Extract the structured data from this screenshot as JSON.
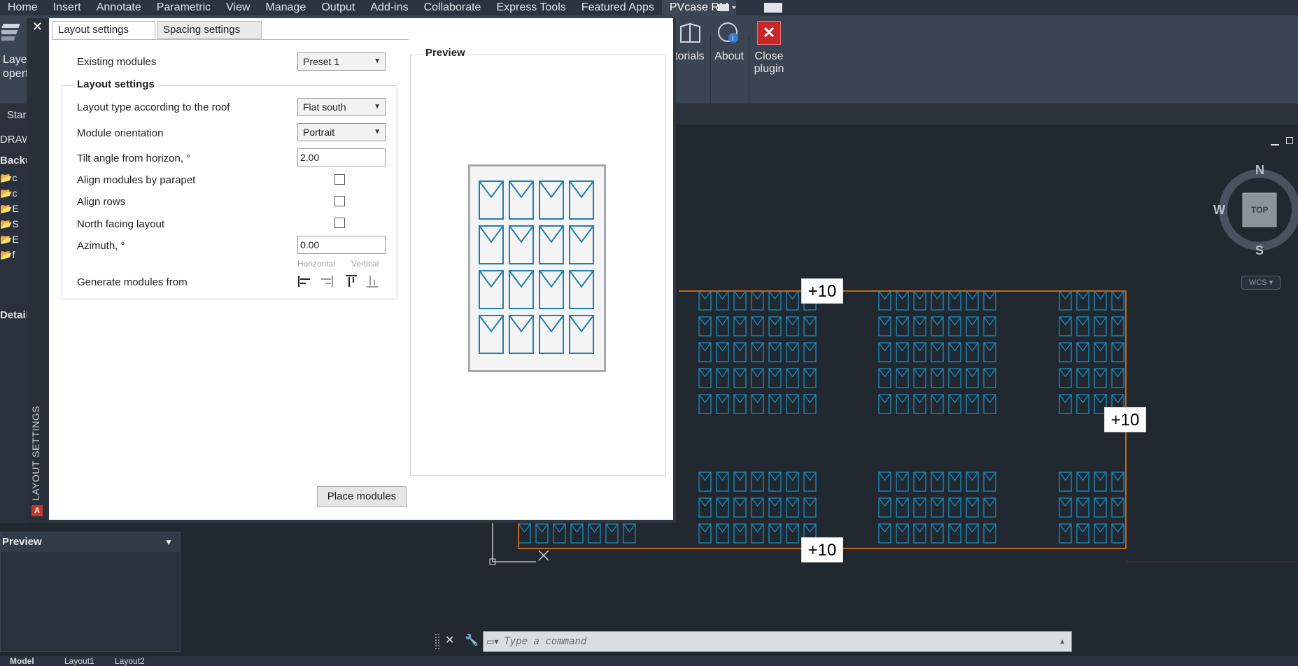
{
  "ribbon": {
    "tabs": [
      "Home",
      "Insert",
      "Annotate",
      "Parametric",
      "View",
      "Manage",
      "Output",
      "Add-ins",
      "Collaborate",
      "Express Tools",
      "Featured Apps",
      "PVcase RM"
    ],
    "active_tab": "PVcase RM",
    "buttons": {
      "layer_props_1": "Layer",
      "layer_props_2": "opert",
      "tutorials": "torials",
      "about": "About",
      "close_plugin_1": "Close",
      "close_plugin_2": "plugin"
    }
  },
  "left_palette": {
    "start_label": "Star",
    "draw_label": "DRAW",
    "backup_label": "Backup",
    "tree_items": [
      "c",
      "c",
      "E",
      "S",
      "E",
      "f"
    ],
    "details_label": "Details",
    "preview_label": "Preview"
  },
  "plugin": {
    "side_label": "LAYOUT SETTINGS",
    "close_glyph": "✕",
    "tabs": [
      "Layout settings",
      "Spacing settings"
    ],
    "existing_modules_label": "Existing modules",
    "existing_modules_value": "Preset 1",
    "group_title": "Layout settings",
    "layout_type_label": "Layout type according to the roof",
    "layout_type_value": "Flat south",
    "orientation_label": "Module orientation",
    "orientation_value": "Portrait",
    "tilt_label": "Tilt angle from horizon, °",
    "tilt_value": "2.00",
    "align_parapet_label": "Align modules by parapet",
    "align_rows_label": "Align rows",
    "north_label": "North facing layout",
    "azimuth_label": "Azimuth, °",
    "azimuth_value": "0.00",
    "horizontal_label": "Horizontal",
    "vertical_label": "Vertical",
    "generate_label": "Generate modules from",
    "preview_title": "Preview",
    "place_button": "Place modules",
    "preview_grid": {
      "rows": 4,
      "cols": 4
    }
  },
  "canvas": {
    "labels": [
      "+10",
      "+10",
      "+10"
    ],
    "viewcube": {
      "n": "N",
      "s": "S",
      "w": "W",
      "top": "TOP",
      "wcs": "WCS"
    },
    "colors": {
      "module": "#1a8ec0",
      "boundary": "#c2661a",
      "background": "#212830"
    }
  },
  "command": {
    "placeholder": "Type a command"
  },
  "status": {
    "model_tab": "Model",
    "layout1": "Layout1",
    "layout2": "Layout2"
  }
}
